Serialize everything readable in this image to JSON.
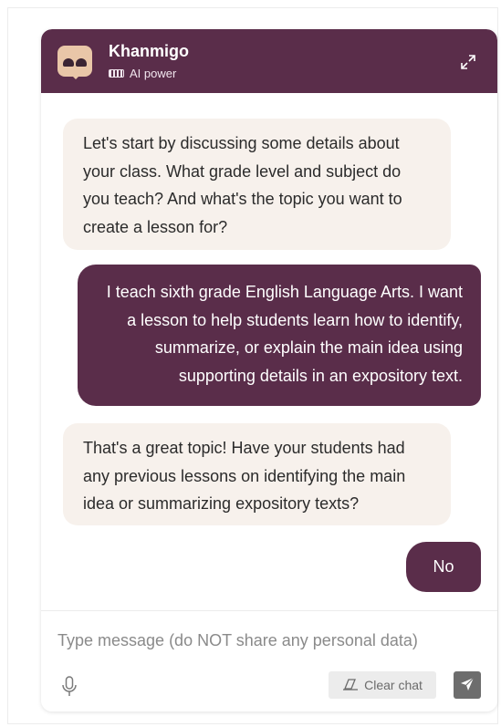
{
  "header": {
    "title": "Khanmigo",
    "subtitle": "AI power",
    "icons": {
      "avatar": "khanmigo-avatar-icon",
      "battery": "battery-icon",
      "expand": "expand-icon"
    }
  },
  "colors": {
    "brand": "#5a2d4a",
    "bot_bubble": "#f7f1ec",
    "user_text": "#ffffff"
  },
  "messages": [
    {
      "role": "assistant",
      "text": "Let's start by discussing some details about your class. What grade level and subject do you teach? And what's the topic you want to create a lesson for?"
    },
    {
      "role": "user",
      "text": "I teach sixth grade English Language Arts. I want a lesson to help students learn how to identify, summarize, or explain the main idea using supporting details in an expository text."
    },
    {
      "role": "assistant",
      "text": "That's a great topic! Have your students had any previous lessons on identifying the main idea or summarizing expository texts?"
    },
    {
      "role": "user",
      "text": "No"
    }
  ],
  "composer": {
    "placeholder": "Type message (do NOT share any personal data)",
    "value": "",
    "clear_label": "Clear chat",
    "icons": {
      "mic": "microphone-icon",
      "clear": "eraser-icon",
      "send": "send-icon"
    }
  }
}
